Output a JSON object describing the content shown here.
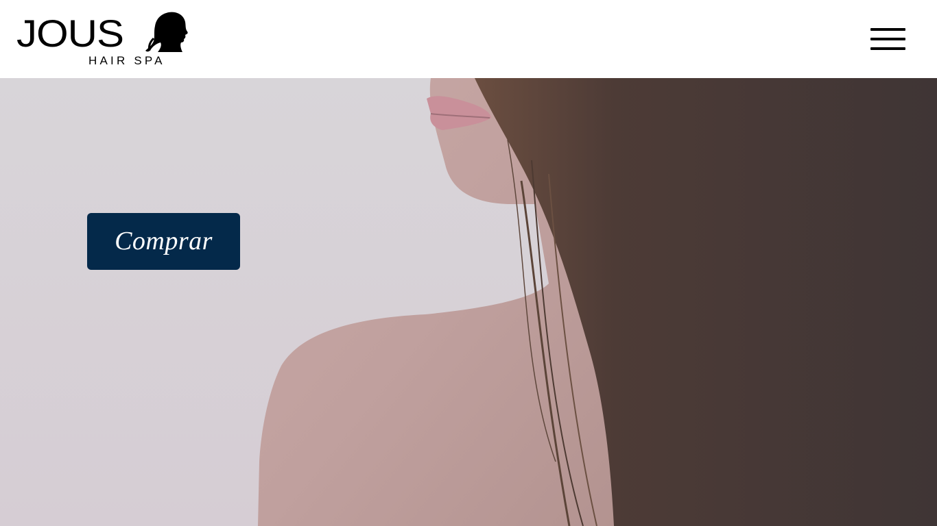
{
  "header": {
    "logo": {
      "word": "JOUS",
      "subtitle": "HAIR SPA",
      "icon": "woman-profile-silhouette"
    },
    "menu_icon": "hamburger-menu-icon"
  },
  "hero": {
    "image": "woman-shoulder-long-hair-photo",
    "cta_label": "Comprar"
  },
  "colors": {
    "cta_background": "#04294a",
    "cta_text": "#ffffff",
    "header_background": "#ffffff"
  }
}
